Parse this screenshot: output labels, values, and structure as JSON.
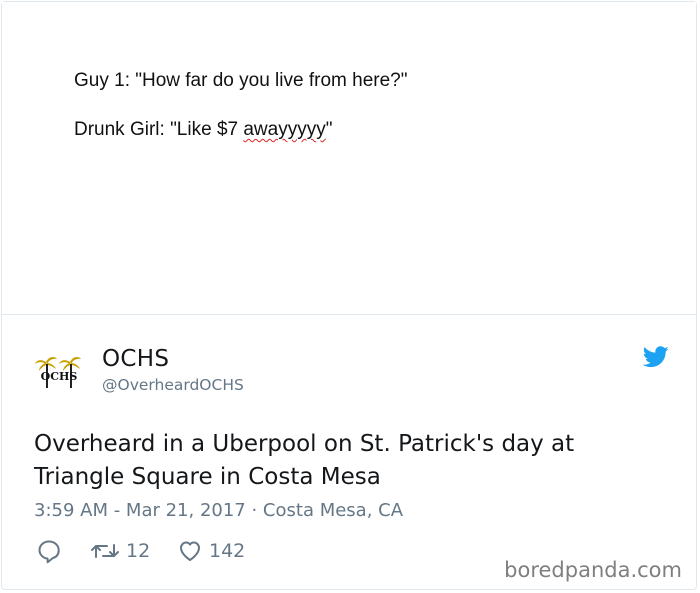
{
  "note": {
    "line1": "Guy 1: \"How far do you live from here?\"",
    "line2_prefix": "Drunk Girl: \"Like $7 ",
    "line2_misspelled": "awayyyyy",
    "line2_suffix": "\""
  },
  "author": {
    "avatar_text": "OCHS",
    "display_name": "OCHS",
    "handle": "@OverheardOCHS"
  },
  "tweet": {
    "text": "Overheard in a Uberpool on St. Patrick's day at Triangle Square in Costa Mesa",
    "timestamp": "3:59 AM - Mar 21, 2017 · Costa Mesa, CA"
  },
  "actions": {
    "retweet_count": "12",
    "like_count": "142"
  },
  "watermark": "boredpanda.com",
  "colors": {
    "twitter_blue": "#1da1f2",
    "text": "#14171a",
    "muted": "#657786"
  },
  "icons": [
    "reply-icon",
    "retweet-icon",
    "heart-icon",
    "twitter-bird-icon"
  ]
}
